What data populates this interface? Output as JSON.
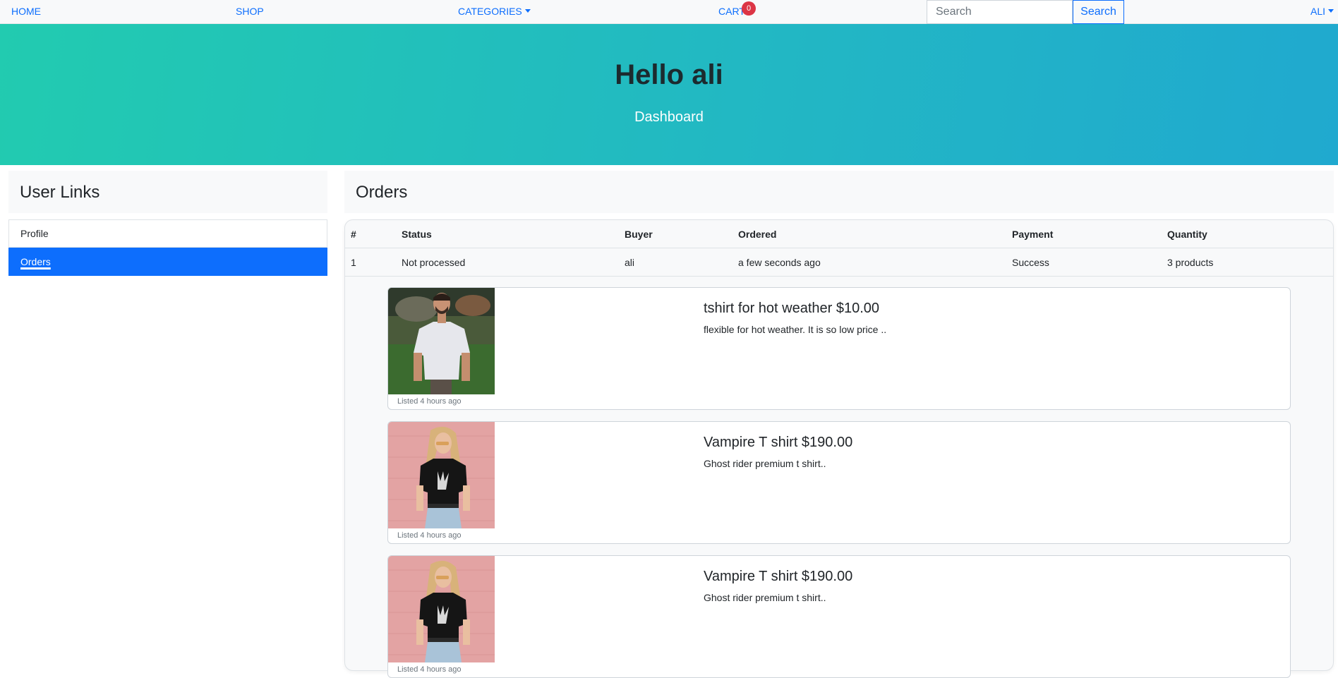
{
  "nav": {
    "home": "HOME",
    "shop": "SHOP",
    "categories": "CATEGORIES",
    "cart": "CART",
    "cart_count": "0",
    "search_placeholder": "Search",
    "search_button": "Search",
    "user": "ALI"
  },
  "hero": {
    "title": "Hello ali",
    "subtitle": "Dashboard"
  },
  "sidebar": {
    "title": "User Links",
    "items": [
      {
        "label": "Profile",
        "active": false
      },
      {
        "label": "Orders",
        "active": true
      }
    ]
  },
  "orders": {
    "title": "Orders",
    "columns": [
      "#",
      "Status",
      "Buyer",
      "Ordered",
      "Payment",
      "Quantity"
    ],
    "rows": [
      [
        "1",
        "Not processed",
        "ali",
        "a few seconds ago",
        "Success",
        "3 products"
      ]
    ],
    "products": [
      {
        "title": "tshirt for hot weather $10.00",
        "description": "flexible for hot weather. It is so low price ..",
        "listed": "Listed 4 hours ago",
        "image": "man-white-tshirt"
      },
      {
        "title": "Vampire T shirt $190.00",
        "description": "Ghost rider premium t shirt..",
        "listed": "Listed 4 hours ago",
        "image": "woman-black-tshirt"
      },
      {
        "title": "Vampire T shirt $190.00",
        "description": "Ghost rider premium t shirt..",
        "listed": "Listed 4 hours ago",
        "image": "woman-black-tshirt"
      }
    ]
  },
  "colors": {
    "primary": "#0d6efd",
    "hero_start": "#22cbb0",
    "hero_end": "#20a9cf",
    "badge": "#dc3545"
  }
}
